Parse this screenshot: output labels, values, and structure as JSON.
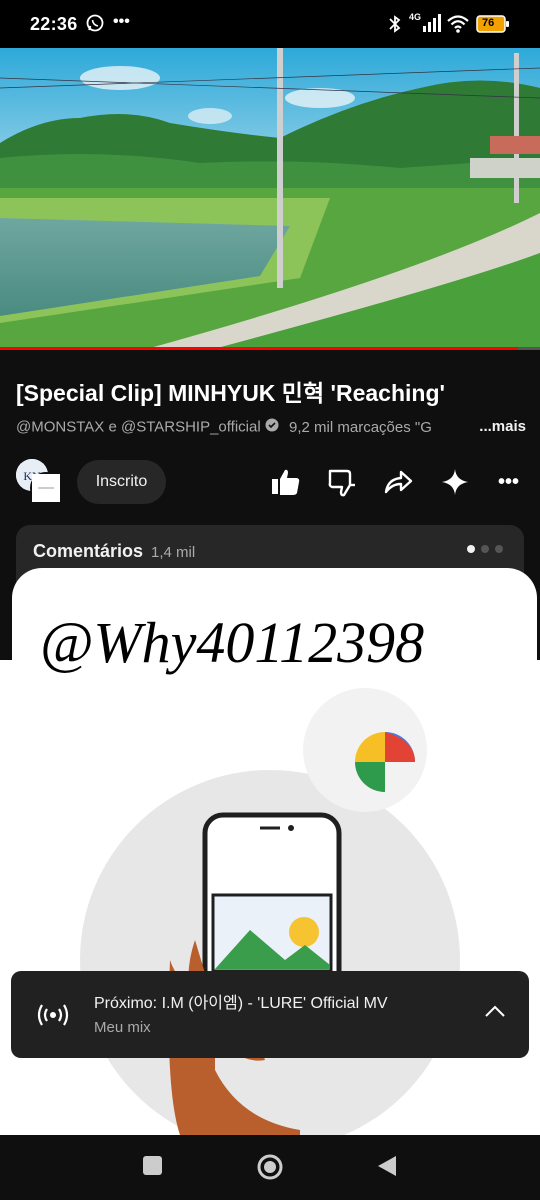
{
  "status_bar": {
    "time": "22:36",
    "network": "4G",
    "battery": "76",
    "icons": [
      "whatsapp-icon",
      "more-notifications-icon",
      "bluetooth-icon",
      "signal-icon",
      "wifi-icon",
      "battery-icon"
    ]
  },
  "video": {
    "title": "[Special Clip] MINHYUK 민혁 'Reaching'",
    "channels": "@MONSTAX e @STARSHIP_official",
    "tags": "9,2 mil marcações \"G",
    "more_label": "...mais",
    "progress": 0.96
  },
  "actions": {
    "subscribed_label": "Inscrito",
    "icons": [
      "like-icon",
      "dislike-icon",
      "share-icon",
      "sparkle-icon",
      "more-icon"
    ]
  },
  "comments": {
    "title": "Comentários",
    "count": "1,4 mil",
    "active_page": 0,
    "pages": 3
  },
  "overlay": {
    "signature": "@Why40112398"
  },
  "up_next": {
    "prefix": "Próximo: ",
    "title": "I.M (아이엠) - 'LURE' Official MV",
    "playlist": "Meu mix"
  },
  "colors": {
    "accent": "#ff0000",
    "background": "#0f0f0f",
    "card": "#272727"
  }
}
